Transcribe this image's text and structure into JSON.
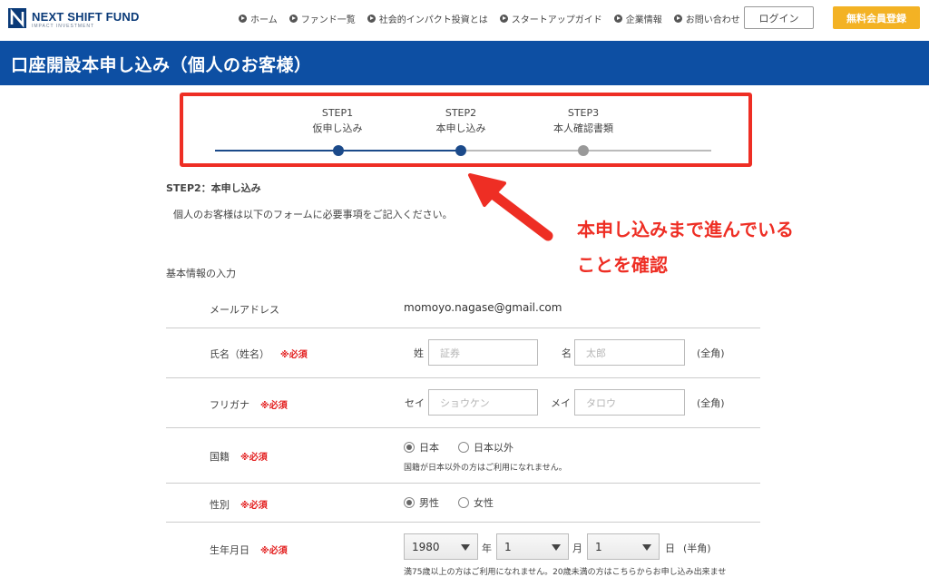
{
  "header": {
    "logo_text": "NEXT SHIFT FUND",
    "logo_sub": "IMPACT INVESTMENT",
    "nav": [
      "ホーム",
      "ファンド一覧",
      "社会的インパクト投資とは",
      "スタートアップガイド",
      "企業情報",
      "お問い合わせ"
    ],
    "login_label": "ログイン",
    "register_label": "無料会員登録",
    "brand_color": "#0d4fa3",
    "accent_color": "#f3b224"
  },
  "page_title": "口座開設本申し込み（個人のお客様）",
  "steps": [
    {
      "step": "STEP1",
      "name": "仮申し込み",
      "state": "done"
    },
    {
      "step": "STEP2",
      "name": "本申し込み",
      "state": "current"
    },
    {
      "step": "STEP3",
      "name": "本人確認書類",
      "state": "pending"
    }
  ],
  "annotation": {
    "line1": "本申し込みまで進んでいる",
    "line2": "ことを確認",
    "color": "#ee2e24"
  },
  "form": {
    "step_heading": "STEP2：本申し込み",
    "intro": "個人のお客様は以下のフォームに必要事項をご記入ください。",
    "section_title": "基本情報の入力",
    "required_label": "※必須",
    "email": {
      "label": "メールアドレス",
      "value": "momoyo.nagase@gmail.com"
    },
    "name": {
      "label": "氏名（姓名）",
      "last_prefix": "姓",
      "last_placeholder": "証券",
      "first_prefix": "名",
      "first_placeholder": "太郎",
      "suffix": "(全角)"
    },
    "kana": {
      "label": "フリガナ",
      "last_prefix": "セイ",
      "last_placeholder": "ショウケン",
      "first_prefix": "メイ",
      "first_placeholder": "タロウ",
      "suffix": "(全角)"
    },
    "nationality": {
      "label": "国籍",
      "options": [
        "日本",
        "日本以外"
      ],
      "selected": "日本",
      "note": "国籍が日本以外の方はご利用になれません。"
    },
    "gender": {
      "label": "性別",
      "options": [
        "男性",
        "女性"
      ],
      "selected": "男性"
    },
    "birthdate": {
      "label": "生年月日",
      "year": "1980",
      "year_unit": "年",
      "month": "1",
      "month_unit": "月",
      "day": "1",
      "day_unit": "日",
      "suffix": "(半角)",
      "note": "満75歳以上の方はご利用になれません。20歳未満の方はこちらからお申し込み出来ませ"
    }
  }
}
